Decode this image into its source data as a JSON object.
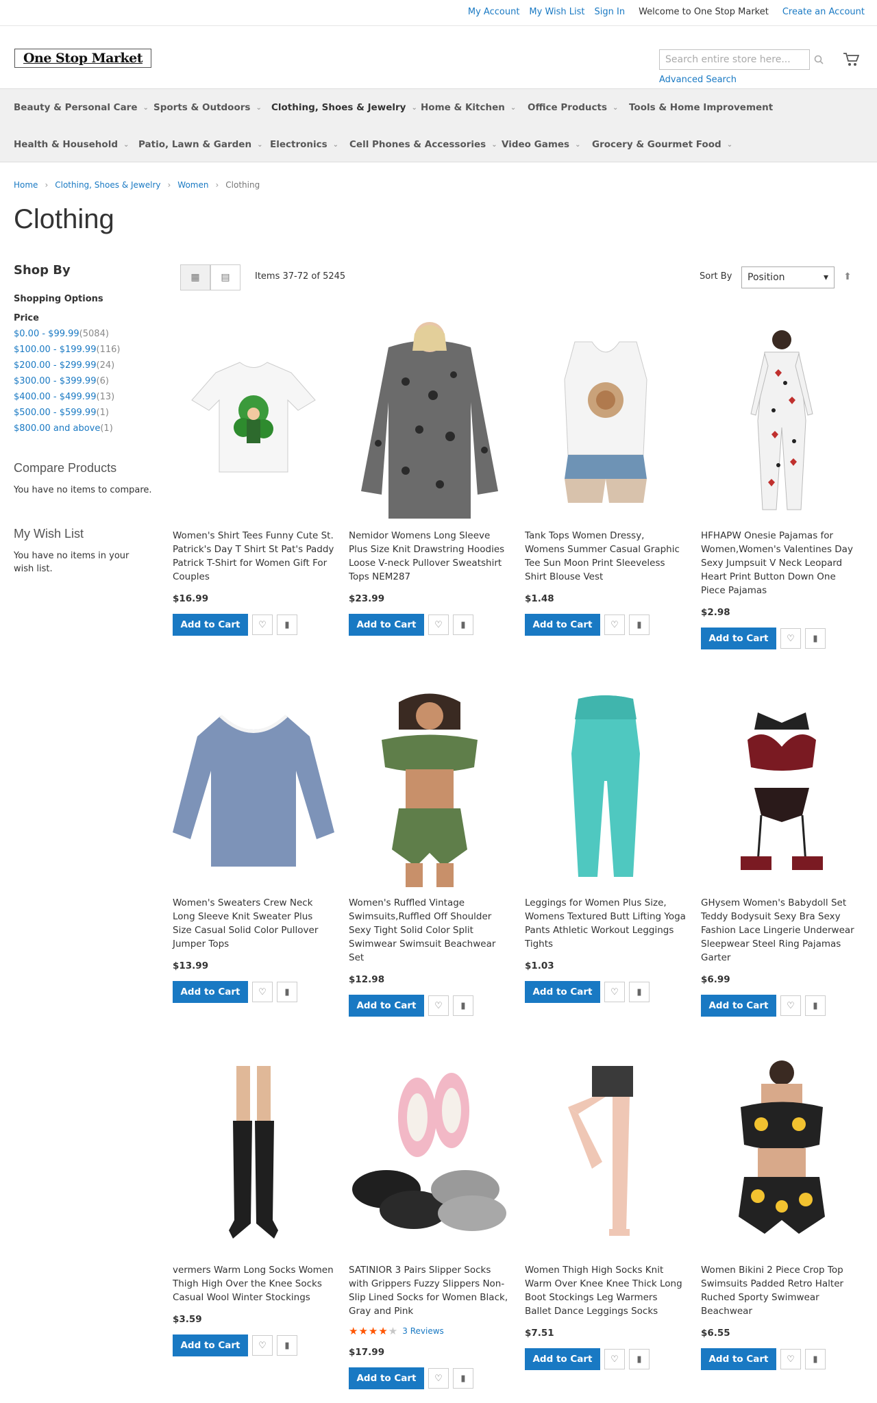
{
  "header": {
    "links": [
      "My Account",
      "My Wish List",
      "Sign In"
    ],
    "welcome": "Welcome to One Stop Market",
    "create_account": "Create an Account",
    "logo": "One Stop Market",
    "search_placeholder": "Search entire store here...",
    "advanced_search": "Advanced Search"
  },
  "nav": {
    "row1": [
      "Beauty & Personal Care",
      "Sports & Outdoors",
      "Clothing, Shoes & Jewelry",
      "Home & Kitchen",
      "Office Products",
      "Tools & Home Improvement"
    ],
    "row2": [
      "Health & Household",
      "Patio, Lawn & Garden",
      "Electronics",
      "Cell Phones & Accessories",
      "Video Games",
      "Grocery & Gourmet Food"
    ]
  },
  "breadcrumb": {
    "home": "Home",
    "cat": "Clothing, Shoes & Jewelry",
    "sub": "Women",
    "current": "Clothing"
  },
  "page_title": "Clothing",
  "sidebar": {
    "shop_by": "Shop By",
    "shopping_options": "Shopping Options",
    "price_title": "Price",
    "prices": [
      {
        "range": "$0.00 - $99.99",
        "count": "5084"
      },
      {
        "range": "$100.00 - $199.99",
        "count": "116"
      },
      {
        "range": "$200.00 - $299.99",
        "count": "24"
      },
      {
        "range": "$300.00 - $399.99",
        "count": "6"
      },
      {
        "range": "$400.00 - $499.99",
        "count": "13"
      },
      {
        "range": "$500.00 - $599.99",
        "count": "1"
      },
      {
        "range": "$800.00 and above",
        "count": "1"
      }
    ],
    "compare_title": "Compare Products",
    "compare_text": "You have no items to compare.",
    "wishlist_title": "My Wish List",
    "wishlist_text": "You have no items in your wish list."
  },
  "toolbar": {
    "amount": "Items 37-72 of 5245",
    "sort_label": "Sort By",
    "sort_value": "Position"
  },
  "add_to_cart": "Add to Cart",
  "products": [
    {
      "name": "Women's Shirt Tees Funny Cute St. Patrick's Day T Shirt St Pat's Paddy Patrick T-Shirt for Women Gift For Couples",
      "price": "$16.99"
    },
    {
      "name": "Nemidor Womens Long Sleeve Plus Size Knit Drawstring Hoodies Loose V-neck Pullover Sweatshirt Tops NEM287",
      "price": "$23.99"
    },
    {
      "name": "Tank Tops Women Dressy, Womens Summer Casual Graphic Tee Sun Moon Print Sleeveless Shirt Blouse Vest",
      "price": "$1.48"
    },
    {
      "name": "HFHAPW Onesie Pajamas for Women,Women's Valentines Day Sexy Jumpsuit V Neck Leopard Heart Print Button Down One Piece Pajamas",
      "price": "$2.98"
    },
    {
      "name": "Women's Sweaters Crew Neck Long Sleeve Knit Sweater Plus Size Casual Solid Color Pullover Jumper Tops",
      "price": "$13.99"
    },
    {
      "name": "Women's Ruffled Vintage Swimsuits,Ruffled Off Shoulder Sexy Tight Solid Color Split Swimwear Swimsuit Beachwear Set",
      "price": "$12.98"
    },
    {
      "name": "Leggings for Women Plus Size, Womens Textured Butt Lifting Yoga Pants Athletic Workout Leggings Tights",
      "price": "$1.03"
    },
    {
      "name": "GHysem Women's Babydoll Set Teddy Bodysuit Sexy Bra Sexy Fashion Lace Lingerie Underwear Sleepwear Steel Ring Pajamas Garter",
      "price": "$6.99"
    },
    {
      "name": "vermers Warm Long Socks Women Thigh High Over the Knee Socks Casual Wool Winter Stockings",
      "price": "$3.59"
    },
    {
      "name": "SATINIOR 3 Pairs Slipper Socks with Grippers Fuzzy Slippers Non-Slip Lined Socks for Women Black, Gray and Pink",
      "price": "$17.99",
      "rating": 4,
      "reviews": "3  Reviews"
    },
    {
      "name": "Women Thigh High Socks Knit Warm Over Knee Knee Thick Long Boot Stockings Leg Warmers Ballet Dance Leggings Socks",
      "price": "$7.51"
    },
    {
      "name": "Women Bikini 2 Piece Crop Top Swimsuits Padded Retro Halter Ruched Sporty Swimwear Beachwear",
      "price": "$6.55"
    }
  ]
}
